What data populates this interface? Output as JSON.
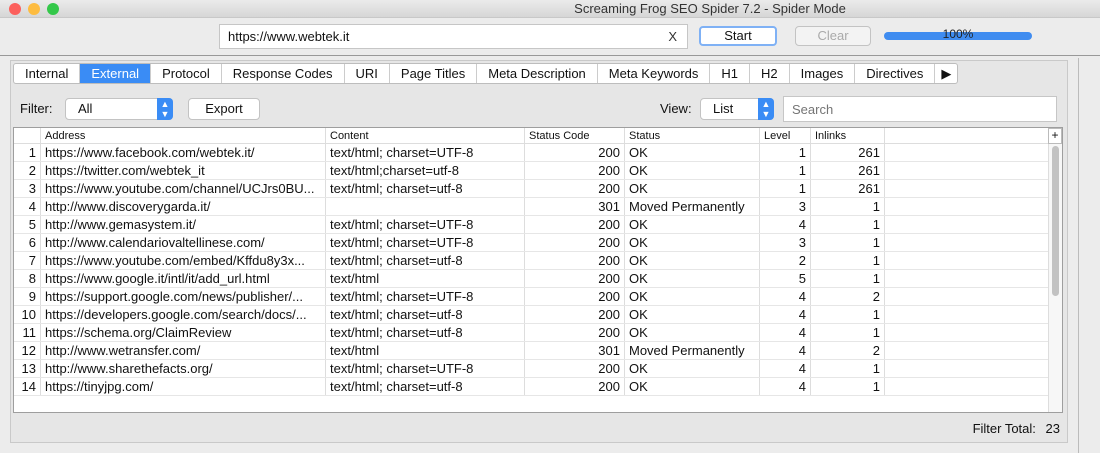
{
  "window": {
    "title": "Screaming Frog SEO Spider 7.2 - Spider Mode"
  },
  "toolbar": {
    "url": "https://www.webtek.it",
    "clear_icon": "X",
    "start": "Start",
    "clear": "Clear",
    "progress_label": "100%",
    "progress": 100
  },
  "tabs": [
    "Internal",
    "External",
    "Protocol",
    "Response Codes",
    "URI",
    "Page Titles",
    "Meta Description",
    "Meta Keywords",
    "H1",
    "H2",
    "Images",
    "Directives"
  ],
  "active_tab": "External",
  "filter": {
    "label": "Filter:",
    "value": "All",
    "export": "Export",
    "view_label": "View:",
    "view_value": "List",
    "search_placeholder": "Search"
  },
  "table": {
    "columns": [
      "Address",
      "Content",
      "Status Code",
      "Status",
      "Level",
      "Inlinks"
    ],
    "rows": [
      [
        "1",
        "https://www.facebook.com/webtek.it/",
        "text/html; charset=UTF-8",
        "200",
        "OK",
        "1",
        "261"
      ],
      [
        "2",
        "https://twitter.com/webtek_it",
        "text/html;charset=utf-8",
        "200",
        "OK",
        "1",
        "261"
      ],
      [
        "3",
        "https://www.youtube.com/channel/UCJrs0BU...",
        "text/html; charset=utf-8",
        "200",
        "OK",
        "1",
        "261"
      ],
      [
        "4",
        "http://www.discoverygarda.it/",
        "",
        "301",
        "Moved Permanently",
        "3",
        "1"
      ],
      [
        "5",
        "http://www.gemasystem.it/",
        "text/html; charset=UTF-8",
        "200",
        "OK",
        "4",
        "1"
      ],
      [
        "6",
        "http://www.calendariovaltellinese.com/",
        "text/html; charset=UTF-8",
        "200",
        "OK",
        "3",
        "1"
      ],
      [
        "7",
        "https://www.youtube.com/embed/Kffdu8y3x...",
        "text/html; charset=utf-8",
        "200",
        "OK",
        "2",
        "1"
      ],
      [
        "8",
        "https://www.google.it/intl/it/add_url.html",
        "text/html",
        "200",
        "OK",
        "5",
        "1"
      ],
      [
        "9",
        "https://support.google.com/news/publisher/...",
        "text/html; charset=UTF-8",
        "200",
        "OK",
        "4",
        "2"
      ],
      [
        "10",
        "https://developers.google.com/search/docs/...",
        "text/html; charset=utf-8",
        "200",
        "OK",
        "4",
        "1"
      ],
      [
        "11",
        "https://schema.org/ClaimReview",
        "text/html; charset=utf-8",
        "200",
        "OK",
        "4",
        "1"
      ],
      [
        "12",
        "http://www.wetransfer.com/",
        "text/html",
        "301",
        "Moved Permanently",
        "4",
        "2"
      ],
      [
        "13",
        "http://www.sharethefacts.org/",
        "text/html; charset=UTF-8",
        "200",
        "OK",
        "4",
        "1"
      ],
      [
        "14",
        "https://tinyjpg.com/",
        "text/html; charset=utf-8",
        "200",
        "OK",
        "4",
        "1"
      ]
    ]
  },
  "footer": {
    "label": "Filter Total:",
    "value": "23"
  }
}
